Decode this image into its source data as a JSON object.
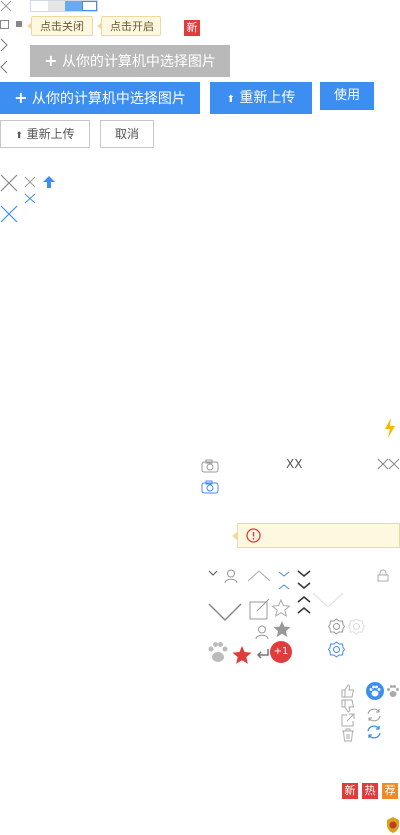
{
  "tooltips": {
    "close": "点击关闭",
    "open": "点击开启"
  },
  "badges": {
    "new": "新",
    "hot": "热",
    "recommend": "荐"
  },
  "buttons": {
    "select_image": "从你的计算机中选择图片",
    "reupload": "重新上传",
    "use": "使用",
    "cancel": "取消"
  },
  "counter_badge": "+1",
  "text_marks": {
    "xx": "XX"
  },
  "colors": {
    "blue": "#3c8ef1",
    "gray_button": "#b9b9b9",
    "red_badge": "#e03c3c",
    "orange_badge": "#f08a24",
    "warning_bg": "#fff8e1",
    "warning_icon": "#e03c3c",
    "lightning": "#f5b800"
  }
}
